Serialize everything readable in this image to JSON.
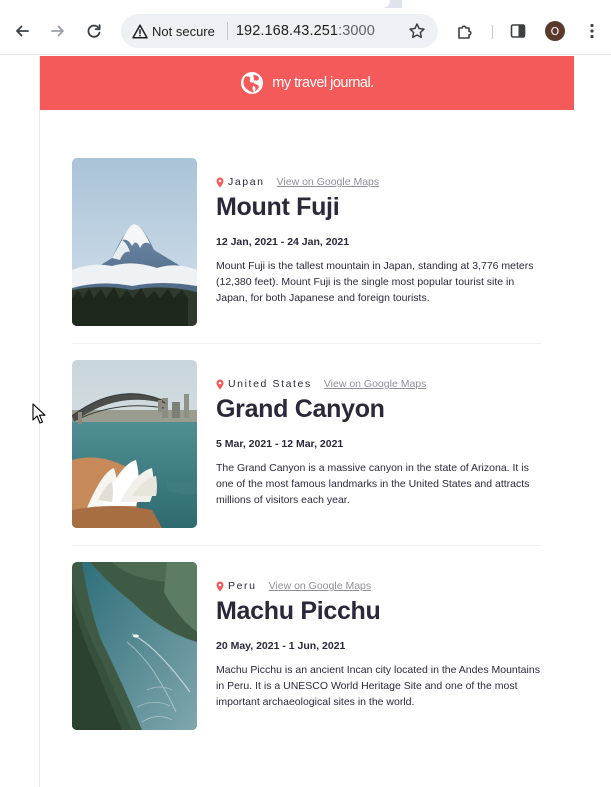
{
  "browser": {
    "security_label": "Not secure",
    "url_host": "192.168.43.251",
    "url_port": ":3000",
    "avatar_initial": "O",
    "icons": [
      "back-arrow-icon",
      "forward-arrow-icon",
      "reload-icon",
      "warning-icon",
      "star-icon",
      "extensions-icon",
      "side-panel-icon",
      "kebab-menu-icon"
    ]
  },
  "header": {
    "title": "my travel journal.",
    "icon": "globe-icon",
    "bg_color": "#f55a5a"
  },
  "entries": [
    {
      "country": "Japan",
      "maps_link": "View on Google Maps",
      "title": "Mount Fuji",
      "dates": "12 Jan, 2021 - 24 Jan, 2021",
      "description": "Mount Fuji is the tallest mountain in Japan, standing at 3,776 meters (12,380 feet). Mount Fuji is the single most popular tourist site in Japan, for both Japanese and foreign tourists."
    },
    {
      "country": "United States",
      "maps_link": "View on Google Maps",
      "title": "Grand Canyon",
      "dates": "5 Mar, 2021 - 12 Mar, 2021",
      "description": "The Grand Canyon is a massive canyon in the state of Arizona. It is one of the most famous landmarks in the United States and attracts millions of visitors each year."
    },
    {
      "country": "Peru",
      "maps_link": "View on Google Maps",
      "title": "Machu Picchu",
      "dates": "20 May, 2021 - 1 Jun, 2021",
      "description": "Machu Picchu is an ancient Incan city located in the Andes Mountains in Peru. It is a UNESCO World Heritage Site and one of the most important archaeological sites in the world."
    }
  ],
  "colors": {
    "accent": "#f55a5a",
    "text": "#2b283a",
    "muted": "#918e9b"
  }
}
